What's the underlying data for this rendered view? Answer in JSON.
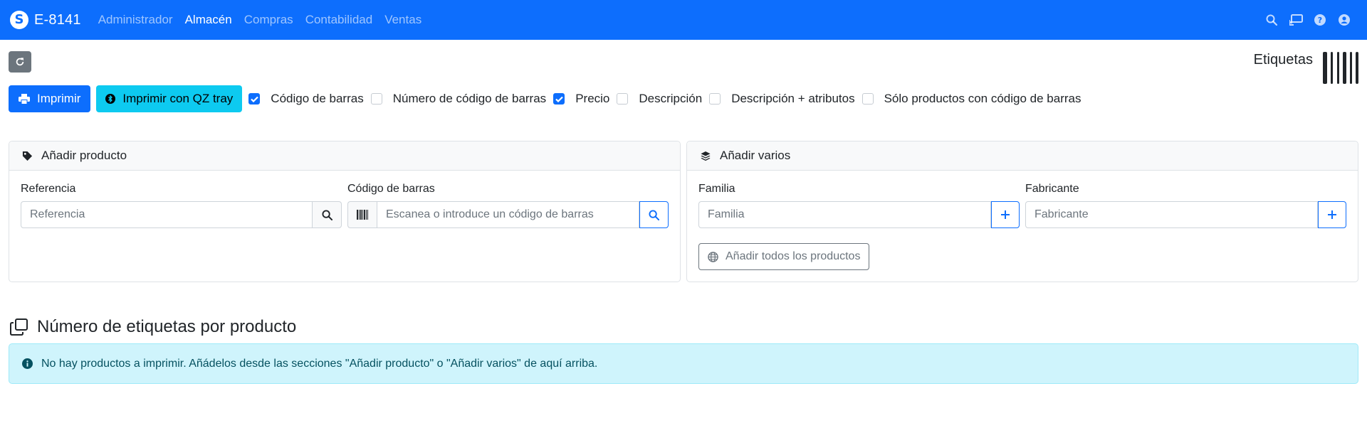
{
  "navbar": {
    "brand_glyph": "S",
    "brand": "E-8141",
    "menu": [
      {
        "label": "Administrador",
        "active": false
      },
      {
        "label": "Almacén",
        "active": true
      },
      {
        "label": "Compras",
        "active": false
      },
      {
        "label": "Contabilidad",
        "active": false
      },
      {
        "label": "Ventas",
        "active": false
      }
    ],
    "icons": [
      "search-icon",
      "screen-cast-icon",
      "help-icon",
      "user-icon"
    ]
  },
  "toolbar": {
    "refresh_icon": "refresh-icon",
    "page_label": "Etiquetas",
    "page_icon": "barcode-icon",
    "print_label": "Imprimir",
    "print_qz_label": "Imprimir con QZ tray",
    "checks": [
      {
        "label": "Código de barras",
        "checked": true
      },
      {
        "label": "Número de código de barras",
        "checked": false
      },
      {
        "label": "Precio",
        "checked": true
      },
      {
        "label": "Descripción",
        "checked": false
      },
      {
        "label": "Descripción + atributos",
        "checked": false
      },
      {
        "label": "Sólo productos con código de barras",
        "checked": false
      }
    ]
  },
  "add_product": {
    "title": "Añadir producto",
    "reference_label": "Referencia",
    "reference_placeholder": "Referencia",
    "barcode_label": "Código de barras",
    "barcode_placeholder": "Escanea o introduce un código de barras"
  },
  "add_multiple": {
    "title": "Añadir varios",
    "family_label": "Familia",
    "family_placeholder": "Familia",
    "manufacturer_label": "Fabricante",
    "manufacturer_placeholder": "Fabricante",
    "add_all_label": "Añadir todos los productos"
  },
  "labels_section": {
    "title": "Número de etiquetas por producto",
    "alert": "No hay productos a imprimir. Añádelos desde las secciones \"Añadir producto\" o \"Añadir varios\" de aquí arriba."
  },
  "colors": {
    "primary": "#0d6efd",
    "info": "#0dcaf0",
    "secondary": "#6c757d",
    "alert_bg": "#cff4fc",
    "alert_text": "#055160"
  }
}
